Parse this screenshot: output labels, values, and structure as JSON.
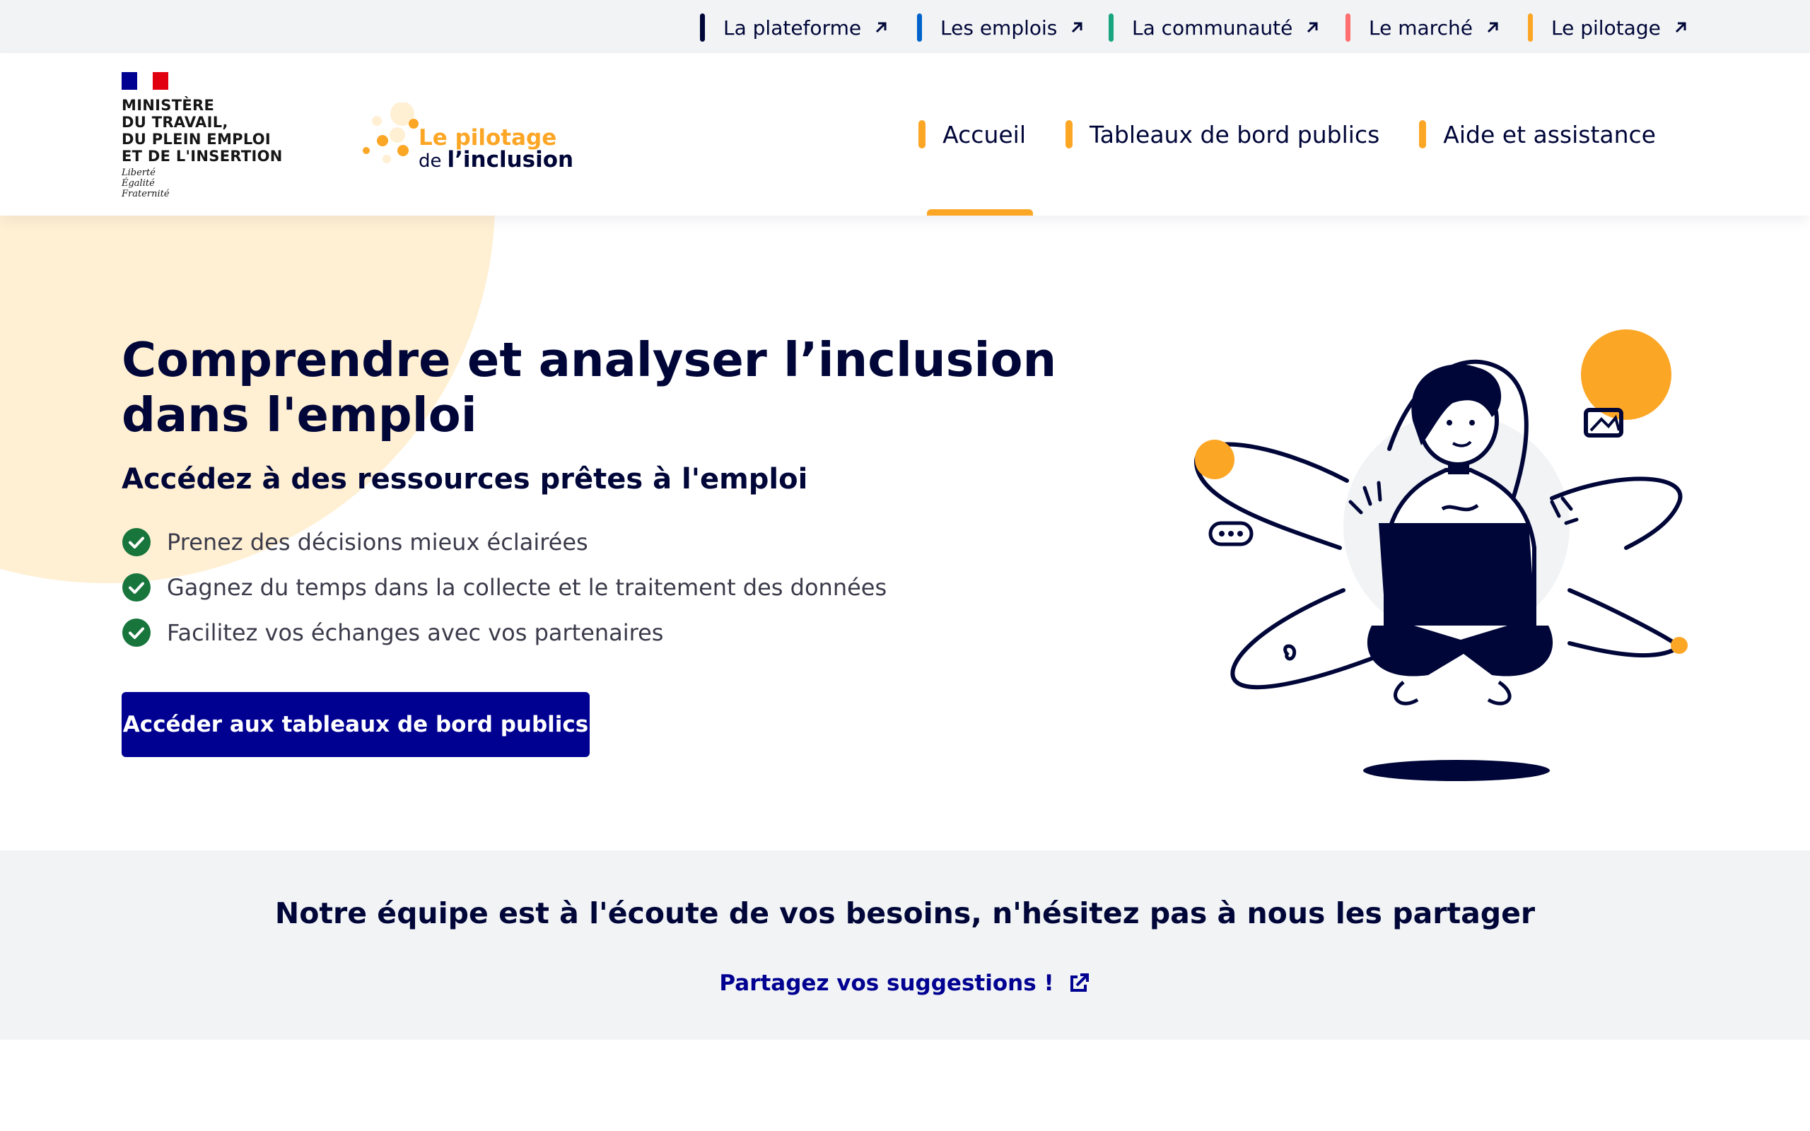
{
  "topbar": {
    "links": [
      {
        "label": "La plateforme",
        "color": "#000638"
      },
      {
        "label": "Les emplois",
        "color": "#0063cb"
      },
      {
        "label": "La communauté",
        "color": "#18a57f"
      },
      {
        "label": "Le marché",
        "color": "#ff6f6f"
      },
      {
        "label": "Le pilotage",
        "color": "#fca626"
      }
    ]
  },
  "header": {
    "ministry": {
      "name": "MINISTÈRE\nDU TRAVAIL,\nDU PLEIN EMPLOI\nET DE L'INSERTION",
      "motto": "Liberté\nÉgalité\nFraternité"
    },
    "brand": {
      "line1": "Le pilotage",
      "line2_prefix": "de",
      "line2_main": "l’inclusion"
    },
    "nav": [
      {
        "label": "Accueil",
        "active": true
      },
      {
        "label": "Tableaux de bord publics",
        "active": false
      },
      {
        "label": "Aide et assistance",
        "active": false
      }
    ]
  },
  "hero": {
    "title": "Comprendre et analyser l’inclusion\ndans l'emploi",
    "subtitle": "Accédez à des ressources prêtes à l'emploi",
    "features": [
      "Prenez des décisions mieux éclairées",
      "Gagnez du temps dans la collecte et le traitement des données",
      "Facilitez vos échanges avec vos partenaires"
    ],
    "cta_label": "Accéder aux tableaux de bord publics"
  },
  "feedback": {
    "title": "Notre équipe est à l'écoute de vos besoins, n'hésitez pas à nous les partager",
    "link_label": "Partagez vos suggestions !"
  },
  "colors": {
    "accent": "#fca626",
    "primary": "#000091",
    "navy": "#000638",
    "check_green": "#18753c",
    "band_gray": "#f1f3f5"
  },
  "icons": {
    "topbar_link": "arrow-up-right-icon",
    "feature": "check-circle-icon",
    "feedback_link": "external-link-icon"
  }
}
